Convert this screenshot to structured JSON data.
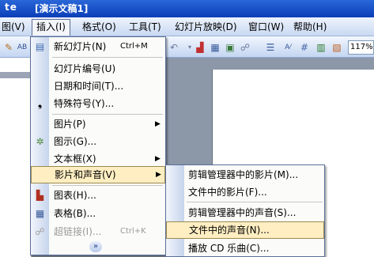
{
  "window": {
    "title_fragment": "te",
    "title": "[演示文稿1]"
  },
  "menubar": [
    {
      "label": "图(V)"
    },
    {
      "label": "插入(I)"
    },
    {
      "label": "格式(O)"
    },
    {
      "label": "工具(T)"
    },
    {
      "label": "幻灯片放映(D)"
    },
    {
      "label": "窗口(W)"
    },
    {
      "label": "帮助(H)"
    }
  ],
  "toolbar": {
    "zoom": "117%"
  },
  "insert_menu": {
    "items": [
      {
        "label": "新幻灯片(N)",
        "shortcut": "Ctrl+M",
        "icon": "new-slide-icon"
      },
      {
        "label": "幻灯片编号(U)"
      },
      {
        "label": "日期和时间(T)..."
      },
      {
        "label": "特殊符号(Y)...",
        "icon": "symbol-icon"
      },
      {
        "label": "图片(P)",
        "submenu": true
      },
      {
        "label": "图示(G)...",
        "icon": "diagram-icon"
      },
      {
        "label": "文本框(X)",
        "submenu": true
      },
      {
        "label": "影片和声音(V)",
        "submenu": true,
        "highlighted": true
      },
      {
        "label": "图表(H)...",
        "icon": "chart-icon"
      },
      {
        "label": "表格(B)...",
        "icon": "table-icon"
      },
      {
        "label": "超链接(I)...",
        "shortcut": "Ctrl+K",
        "disabled": true,
        "icon": "hyperlink-icon"
      }
    ],
    "expand": "»"
  },
  "movies_sounds_submenu": {
    "items": [
      {
        "label": "剪辑管理器中的影片(M)..."
      },
      {
        "label": "文件中的影片(F)..."
      },
      {
        "label": "剪辑管理器中的声音(S)..."
      },
      {
        "label": "文件中的声音(N)...",
        "highlighted": true
      },
      {
        "label": "播放 CD 乐曲(C)..."
      }
    ]
  },
  "colors": {
    "highlight": "#ffeec2",
    "menu_border": "#5a6f99",
    "titlebar": "#0a3eb8"
  }
}
